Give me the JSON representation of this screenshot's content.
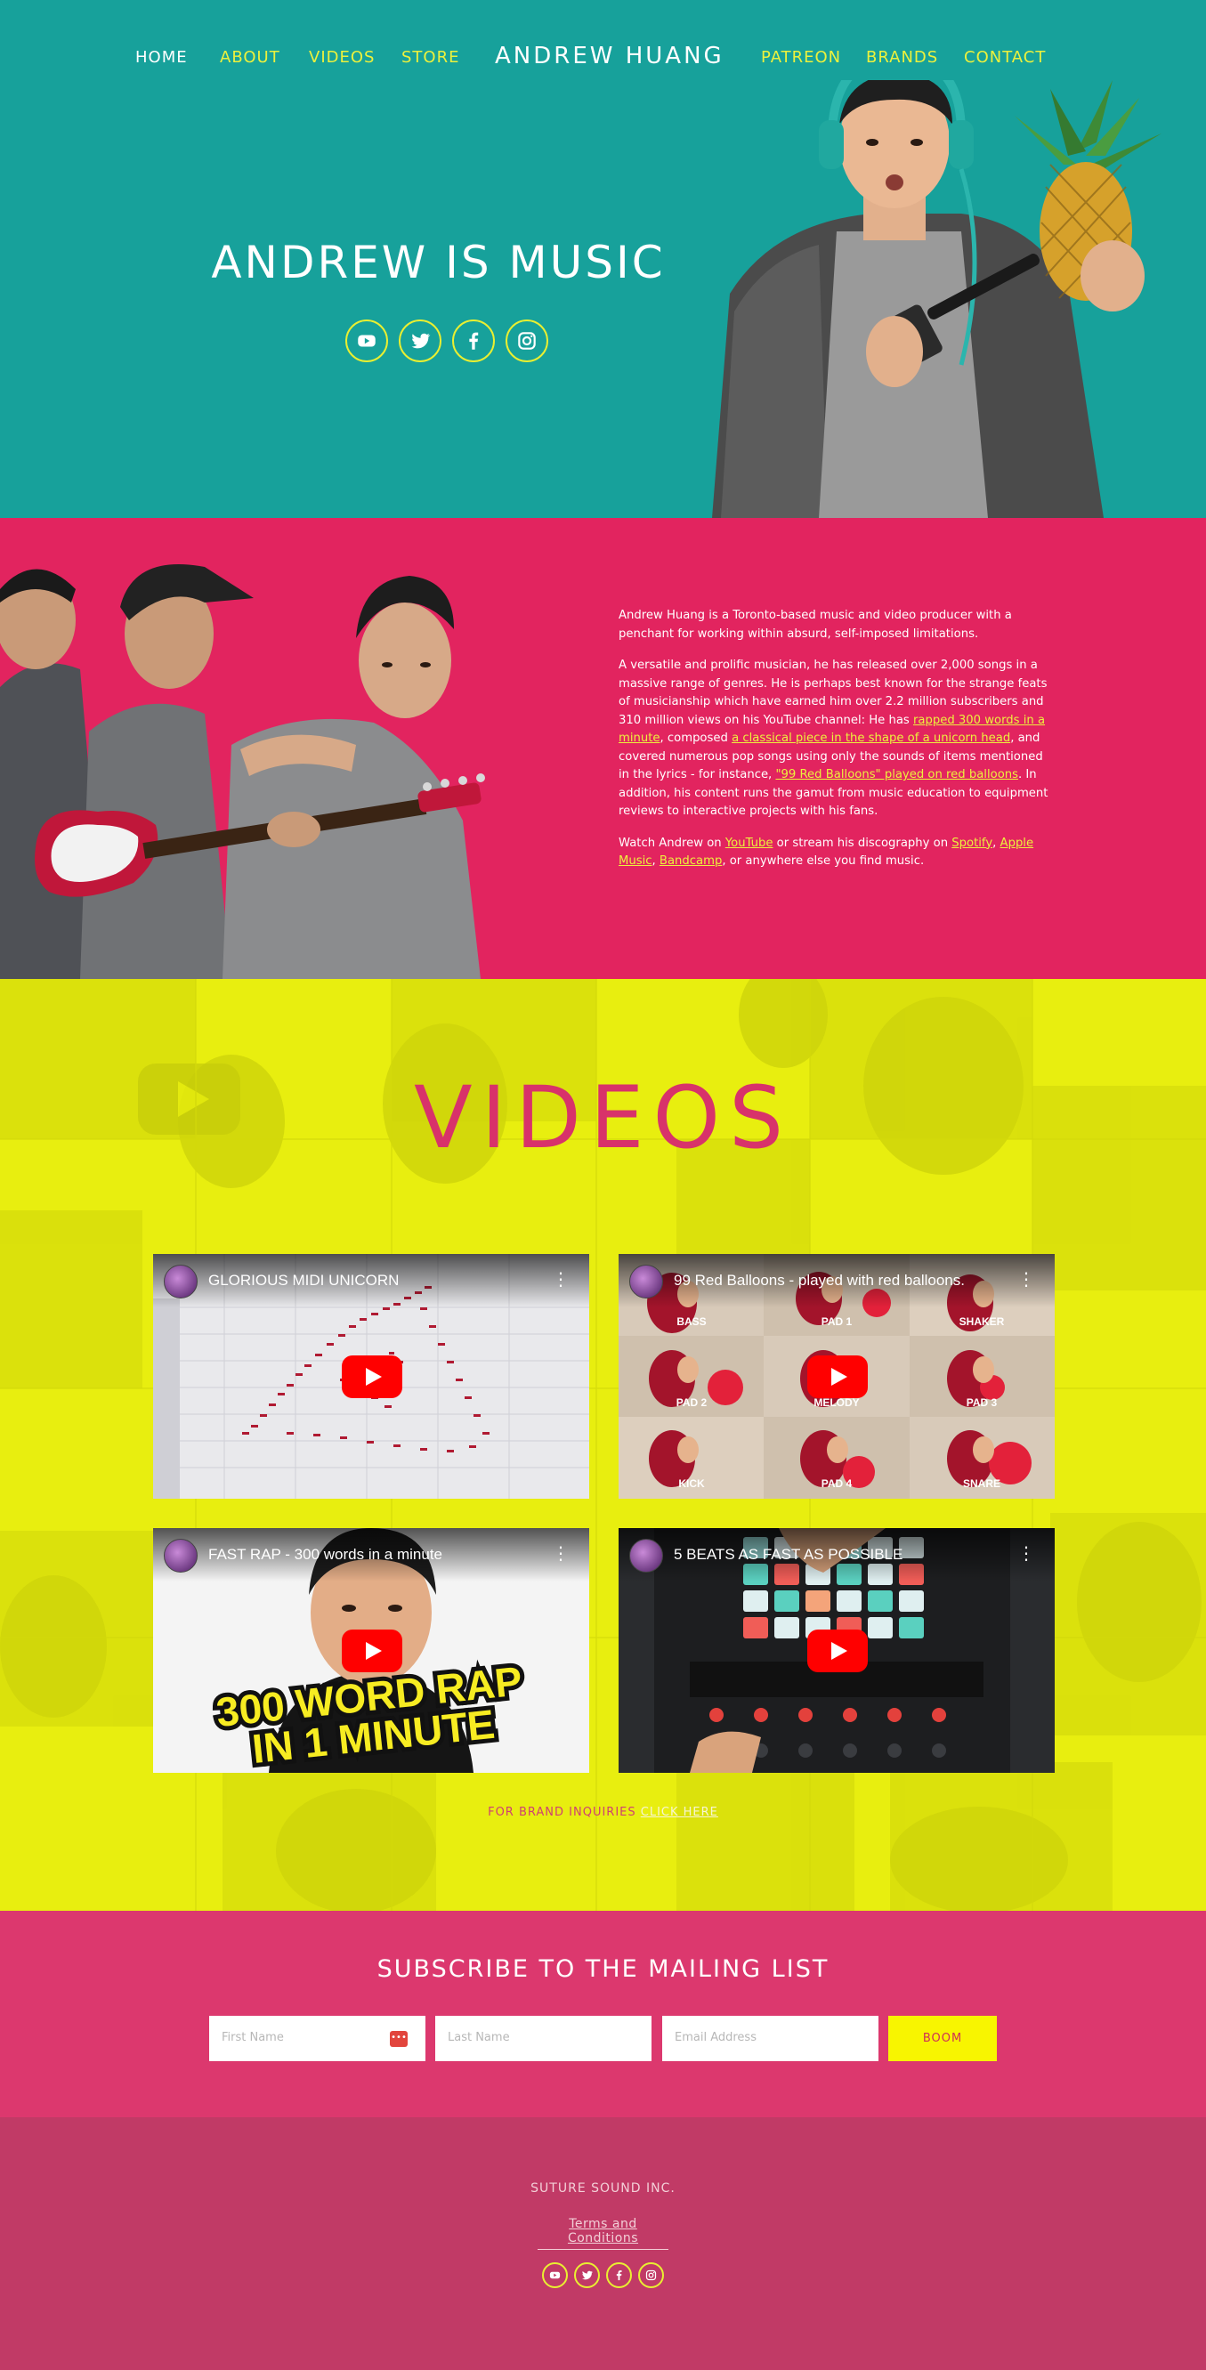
{
  "nav": {
    "left": [
      {
        "label": "HOME",
        "active": true
      },
      {
        "label": "ABOUT",
        "active": false
      },
      {
        "label": "VIDEOS",
        "active": false
      },
      {
        "label": "STORE",
        "active": false
      }
    ],
    "brand": "ANDREW HUANG",
    "right": [
      {
        "label": "PATREON"
      },
      {
        "label": "BRANDS"
      },
      {
        "label": "CONTACT"
      }
    ]
  },
  "hero": {
    "title": "ANDREW IS MUSIC",
    "social_icons": [
      "youtube-icon",
      "twitter-icon",
      "facebook-icon",
      "instagram-icon"
    ]
  },
  "about": {
    "p1": "Andrew Huang is a Toronto-based music and video producer with a penchant for working within absurd, self-imposed limitations.",
    "p2_a": "A versatile and prolific musician, he has released over 2,000 songs in a massive range of genres. He is perhaps best known for the strange feats of musicianship which have earned him over 2.2 million subscribers and 310 million views on his YouTube channel: He has ",
    "p2_link1": "rapped 300 words in a minute",
    "p2_b": ", composed ",
    "p2_link2": "a classical piece in the shape of a unicorn head",
    "p2_c": ", and covered numerous pop songs using only the sounds of items mentioned in the lyrics - for instance, ",
    "p2_link3": "\"99 Red Balloons\" played on red balloons",
    "p2_d": ". In addition, his content runs the gamut from music education to equipment reviews to interactive projects with his fans.",
    "p3_a": "Watch Andrew on ",
    "p3_link1": "YouTube",
    "p3_b": " or stream his discography on ",
    "p3_link2": "Spotify",
    "p3_c": ", ",
    "p3_link3": "Apple Music",
    "p3_d": ", ",
    "p3_link4": "Bandcamp",
    "p3_e": ", or anywhere else you find music."
  },
  "videos": {
    "title": "VIDEOS",
    "items": [
      {
        "title": "GLORIOUS MIDI UNICORN"
      },
      {
        "title": "99 Red Balloons - played with red balloons."
      },
      {
        "title": "FAST RAP - 300 words in a minute"
      },
      {
        "title": "5 BEATS AS FAST AS POSSIBLE"
      }
    ],
    "balloon_labels": [
      "BASS",
      "PAD 1",
      "SHAKER",
      "PAD 2",
      "MELODY",
      "PAD 3",
      "KICK",
      "PAD 4",
      "SNARE"
    ],
    "rap_caption_line1": "300 WORD RAP",
    "rap_caption_line2": "IN 1 MINUTE",
    "brand_inquiries_a": "FOR BRAND INQUIRIES ",
    "brand_inquiries_b": "CLICK HERE"
  },
  "subscribe": {
    "title": "SUBSCRIBE TO THE MAILING LIST",
    "first_name_placeholder": "First Name",
    "last_name_placeholder": "Last Name",
    "email_placeholder": "Email Address",
    "button": "BOOM"
  },
  "footer": {
    "company": "SUTURE SOUND INC.",
    "terms": "Terms and Conditions"
  },
  "colors": {
    "teal": "#17a19b",
    "pink": "#e2245f",
    "yellow": "#e8ee0f",
    "subscribe_pink": "#dc386e",
    "footer_pink": "#c13a66",
    "accent_yellow": "#ecf13d"
  }
}
